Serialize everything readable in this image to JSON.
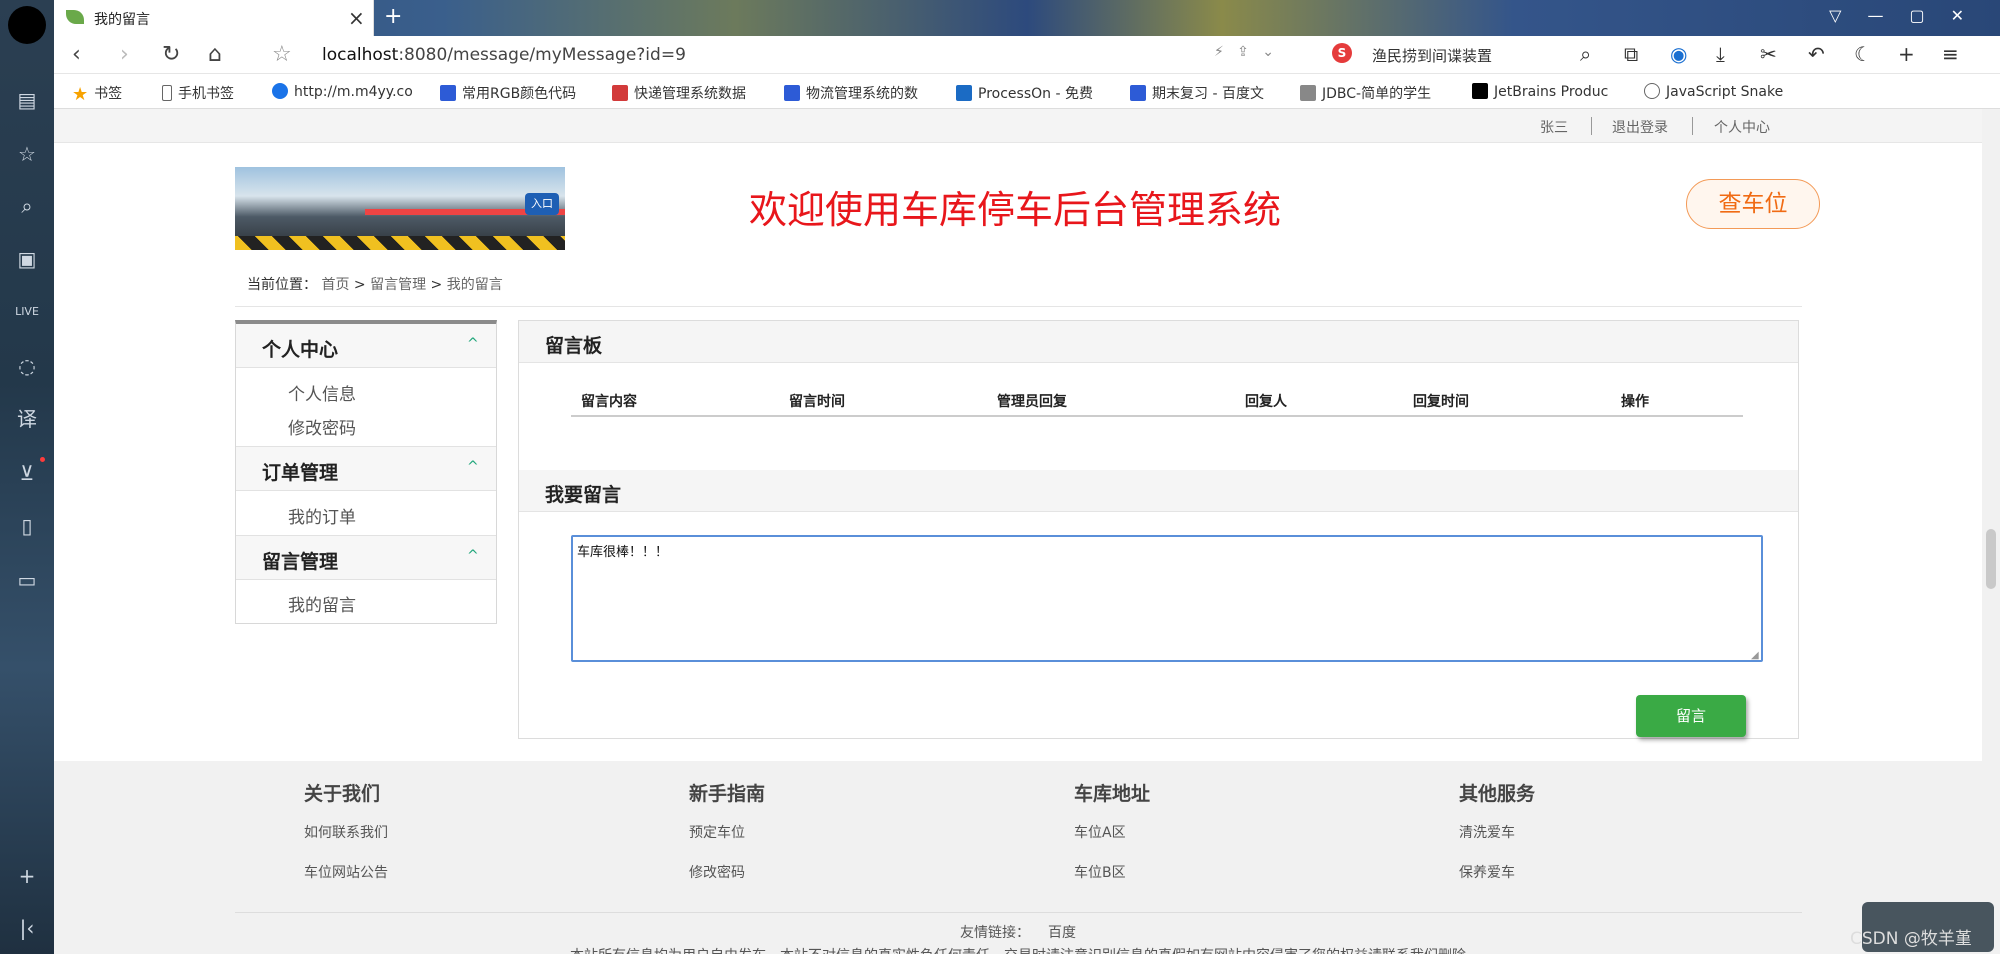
{
  "browser": {
    "tab_title": "我的留言",
    "url_host": "localhost",
    "url_path": ":8080/message/myMessage?id=9",
    "search_text": "渔民捞到间谍装置",
    "bookmarks": [
      "书签",
      "手机书签",
      "http://m.m4yy.co",
      "常用RGB颜色代码",
      "快递管理系统数据",
      "物流管理系统的数",
      "ProcessOn - 免费",
      "期末复习 - 百度文",
      "JDBC-简单的学生",
      "JetBrains Produc",
      "JavaScript Snake"
    ]
  },
  "top_links": {
    "user": "张三",
    "logout": "退出登录",
    "center": "个人中心"
  },
  "header": {
    "title": "欢迎使用车库停车后台管理系统",
    "find_button": "查车位",
    "banner_badge": "入口"
  },
  "breadcrumb": {
    "label": "当前位置：",
    "home": "首页",
    "sep": ">",
    "parent": "留言管理",
    "current": "我的留言"
  },
  "sidebar": {
    "groups": [
      {
        "title": "个人中心",
        "items": [
          "个人信息",
          "修改密码"
        ]
      },
      {
        "title": "订单管理",
        "items": [
          "我的订单"
        ]
      },
      {
        "title": "留言管理",
        "items": [
          "我的留言"
        ]
      }
    ],
    "arrow": "^"
  },
  "board": {
    "title": "留言板",
    "columns": [
      "留言内容",
      "留言时间",
      "管理员回复",
      "回复人",
      "回复时间",
      "操作"
    ]
  },
  "compose": {
    "title": "我要留言",
    "value": "车库很棒！！！",
    "submit": "留言"
  },
  "footer": {
    "cols": [
      {
        "title": "关于我们",
        "links": [
          "如何联系我们",
          "车位网站公告"
        ]
      },
      {
        "title": "新手指南",
        "links": [
          "预定车位",
          "修改密码"
        ]
      },
      {
        "title": "车库地址",
        "links": [
          "车位A区",
          "车位B区"
        ]
      },
      {
        "title": "其他服务",
        "links": [
          "清洗爱车",
          "保养爱车"
        ]
      }
    ],
    "friend_label": "友情链接：",
    "friend_link": "百度",
    "disclaimer": "本站所有信息均为用户自由发布，本站不对信息的真实性负任何责任，交易时请注意识别信息的真假如有网站内容侵害了您的权益请联系我们删除"
  },
  "watermark": "CSDN @牧羊堇"
}
